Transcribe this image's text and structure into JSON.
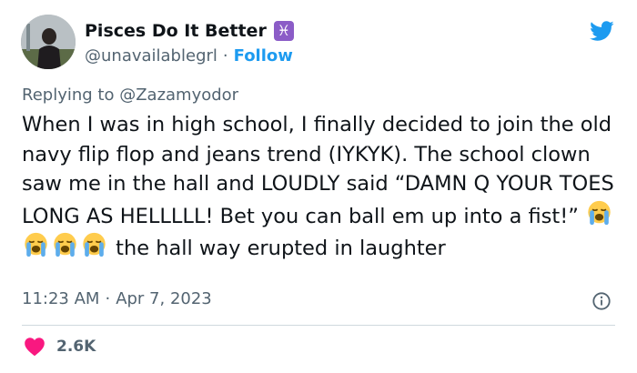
{
  "author": {
    "display_name": "Pisces Do It Better",
    "zodiac_badge": "♓",
    "handle": "@unavailablegrl",
    "separator": "·",
    "follow_label": "Follow"
  },
  "reply": {
    "prefix": "Replying to ",
    "mention": "@Zazamyodor"
  },
  "tweet": {
    "text_before_emoji": "When I was in high school, I finally decided to join the old navy flip flop and jeans trend (IYKYK). The school clown saw me in the hall and LOUDLY said “DAMN Q YOUR TOES LONG AS HELLLLL! Bet you can ball em up into a fist!” ",
    "emoji": [
      "loudly-crying-face",
      "loudly-crying-face",
      "loudly-crying-face",
      "loudly-crying-face"
    ],
    "text_after_emoji": " the hall way erupted in laughter"
  },
  "meta": {
    "time": "11:23 AM",
    "separator": "·",
    "date": "Apr 7, 2023"
  },
  "engagement": {
    "likes": "2.6K"
  },
  "colors": {
    "twitter_blue": "#1d9bf0",
    "heart_red": "#f91880",
    "secondary_text": "#536471",
    "primary_text": "#0f1419",
    "divider": "#cfd9de",
    "badge_purple": "#8b5cc7"
  },
  "icons": [
    "avatar-photo",
    "pisces-badge-icon",
    "twitter-bird-icon",
    "info-icon",
    "heart-icon",
    "loudly-crying-face-emoji"
  ]
}
